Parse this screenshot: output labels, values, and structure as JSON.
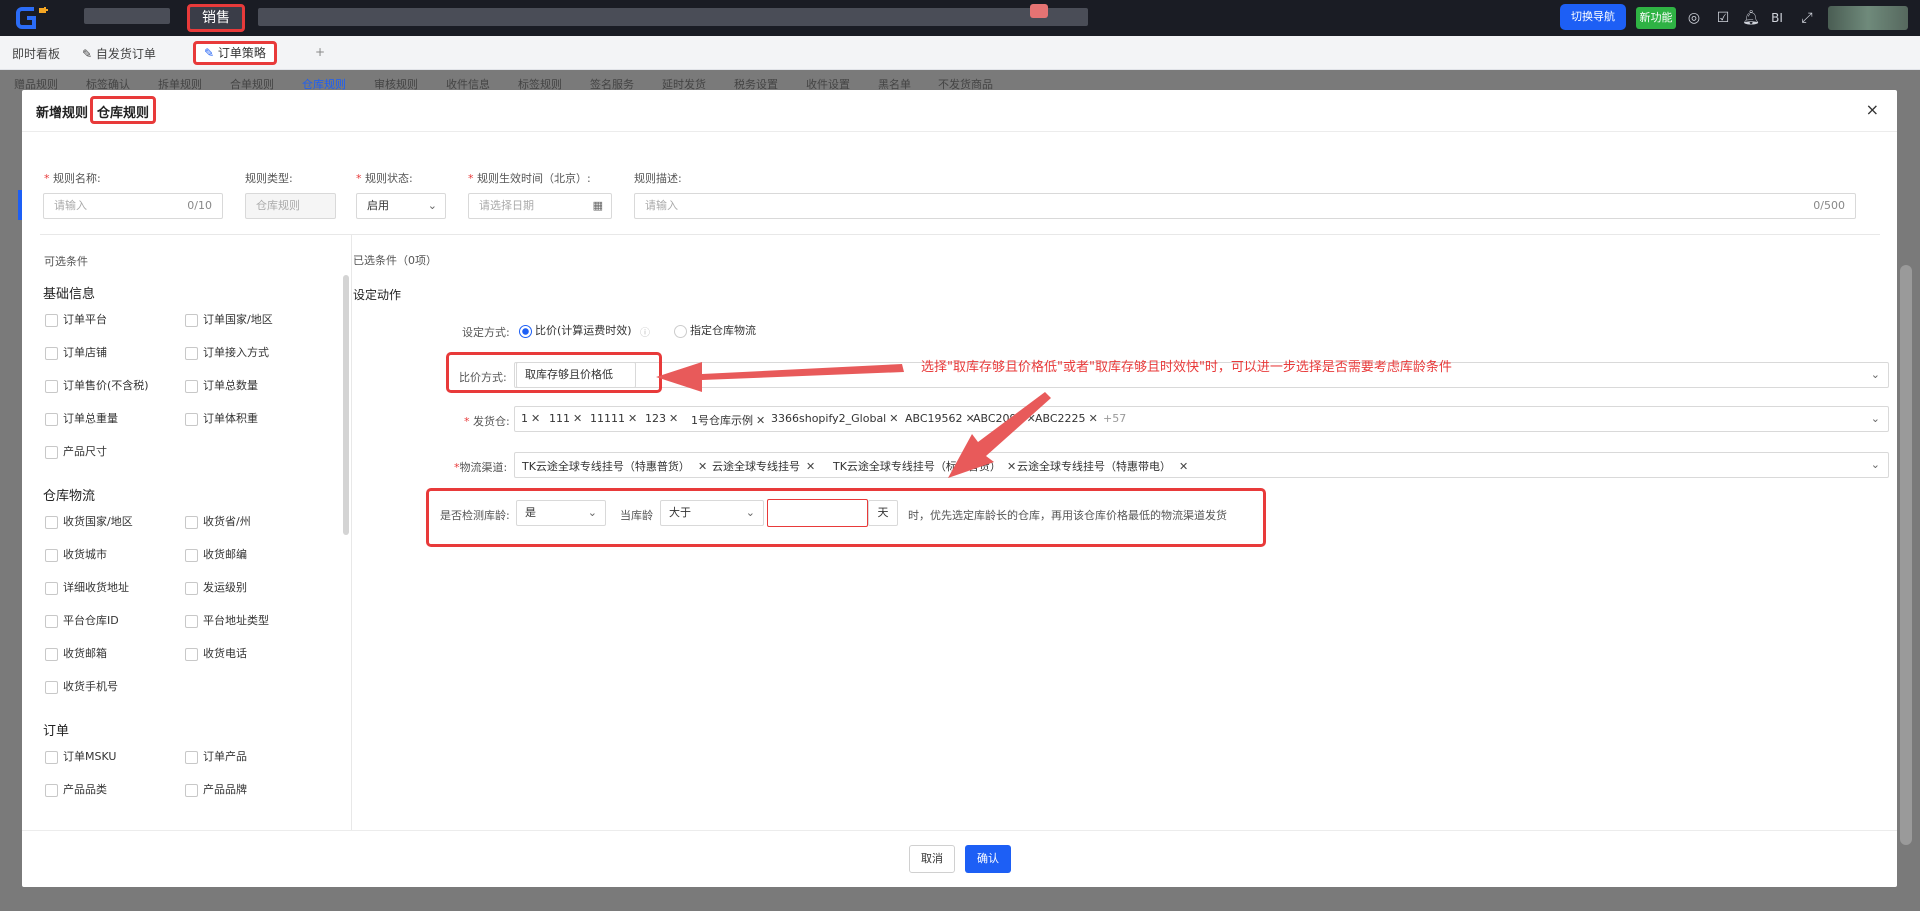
{
  "topbar": {
    "sales_label": "销售",
    "switch_nav_label": "切换导航",
    "new_feature_label": "新功能",
    "bi_label": "BI"
  },
  "tabs": {
    "dashboard": "即时看板",
    "self_ship": "自发货订单",
    "active": "订单策略",
    "add": "+"
  },
  "subnav": [
    "赠品规则",
    "标签确认",
    "拆单规则",
    "合单规则",
    "仓库规则",
    "审核规则",
    "收件信息",
    "标签规则",
    "签名服务",
    "延时发货",
    "税务设置",
    "收件设置",
    "黑名单",
    "不发货商品"
  ],
  "modal": {
    "title_prefix": "新增规则",
    "title_highlight": "仓库规则",
    "close": "×",
    "fields": {
      "rule_name_label": "规则名称:",
      "rule_name_placeholder": "请输入",
      "rule_name_count": "0/10",
      "rule_type_label": "规则类型:",
      "rule_type_value": "仓库规则",
      "rule_status_label": "规则状态:",
      "rule_status_value": "启用",
      "effective_time_label": "规则生效时间（北京）:",
      "effective_time_placeholder": "请选择日期",
      "description_label": "规则描述:",
      "description_placeholder": "请输入",
      "description_count": "0/500"
    },
    "left": {
      "title": "可选条件",
      "groups": [
        {
          "name": "基础信息",
          "items": [
            "订单平台",
            "订单国家/地区",
            "订单店铺",
            "订单接入方式",
            "订单售价(不含税)",
            "订单总数量",
            "订单总重量",
            "订单体积重",
            "产品尺寸"
          ]
        },
        {
          "name": "仓库物流",
          "items": [
            "收货国家/地区",
            "收货省/州",
            "收货城市",
            "收货邮编",
            "详细收货地址",
            "发运级别",
            "平台仓库ID",
            "平台地址类型",
            "收货邮箱",
            "收货电话",
            "收货手机号"
          ]
        },
        {
          "name": "订单",
          "items": [
            "订单MSKU",
            "订单产品",
            "产品品类",
            "产品品牌"
          ]
        }
      ]
    },
    "right": {
      "selected_label": "已选条件（0项）",
      "action_title": "设定动作",
      "mode_label": "设定方式:",
      "mode_options": [
        "比价(计算运费时效)",
        "指定仓库物流"
      ],
      "compare_label": "比价方式:",
      "compare_value": "取库存够且价格低",
      "warehouse_label": "发货仓:",
      "warehouse_tags": [
        "1",
        "111",
        "11111",
        "123",
        "1号仓库示例",
        "3366shopify2_Global",
        "ABC19562",
        "ABC2091",
        "ABC2225"
      ],
      "warehouse_more": "+57",
      "channel_label": "物流渠道:",
      "channel_tags": [
        "TK云途全球专线挂号（特惠普货）",
        "云途全球专线挂号",
        "TK云途全球专线挂号（标快普货）",
        "云途全球专线挂号（特惠带电）"
      ],
      "age_check_label": "是否检测库龄:",
      "age_check_value": "是",
      "age_label": "当库龄",
      "age_op_value": "大于",
      "age_unit": "天",
      "age_hint": "时，优先选定库龄长的仓库，再用该仓库价格最低的物流渠道发货",
      "annotation": "选择\"取库存够且价格低\"或者\"取库存够且时效快\"时，可以进一步选择是否需要考虑库龄条件"
    },
    "footer": {
      "cancel": "取消",
      "confirm": "确认"
    }
  },
  "colors": {
    "accent": "#1d5ff5",
    "highlight": "#e83a3a",
    "new_badge": "#2fb344"
  }
}
